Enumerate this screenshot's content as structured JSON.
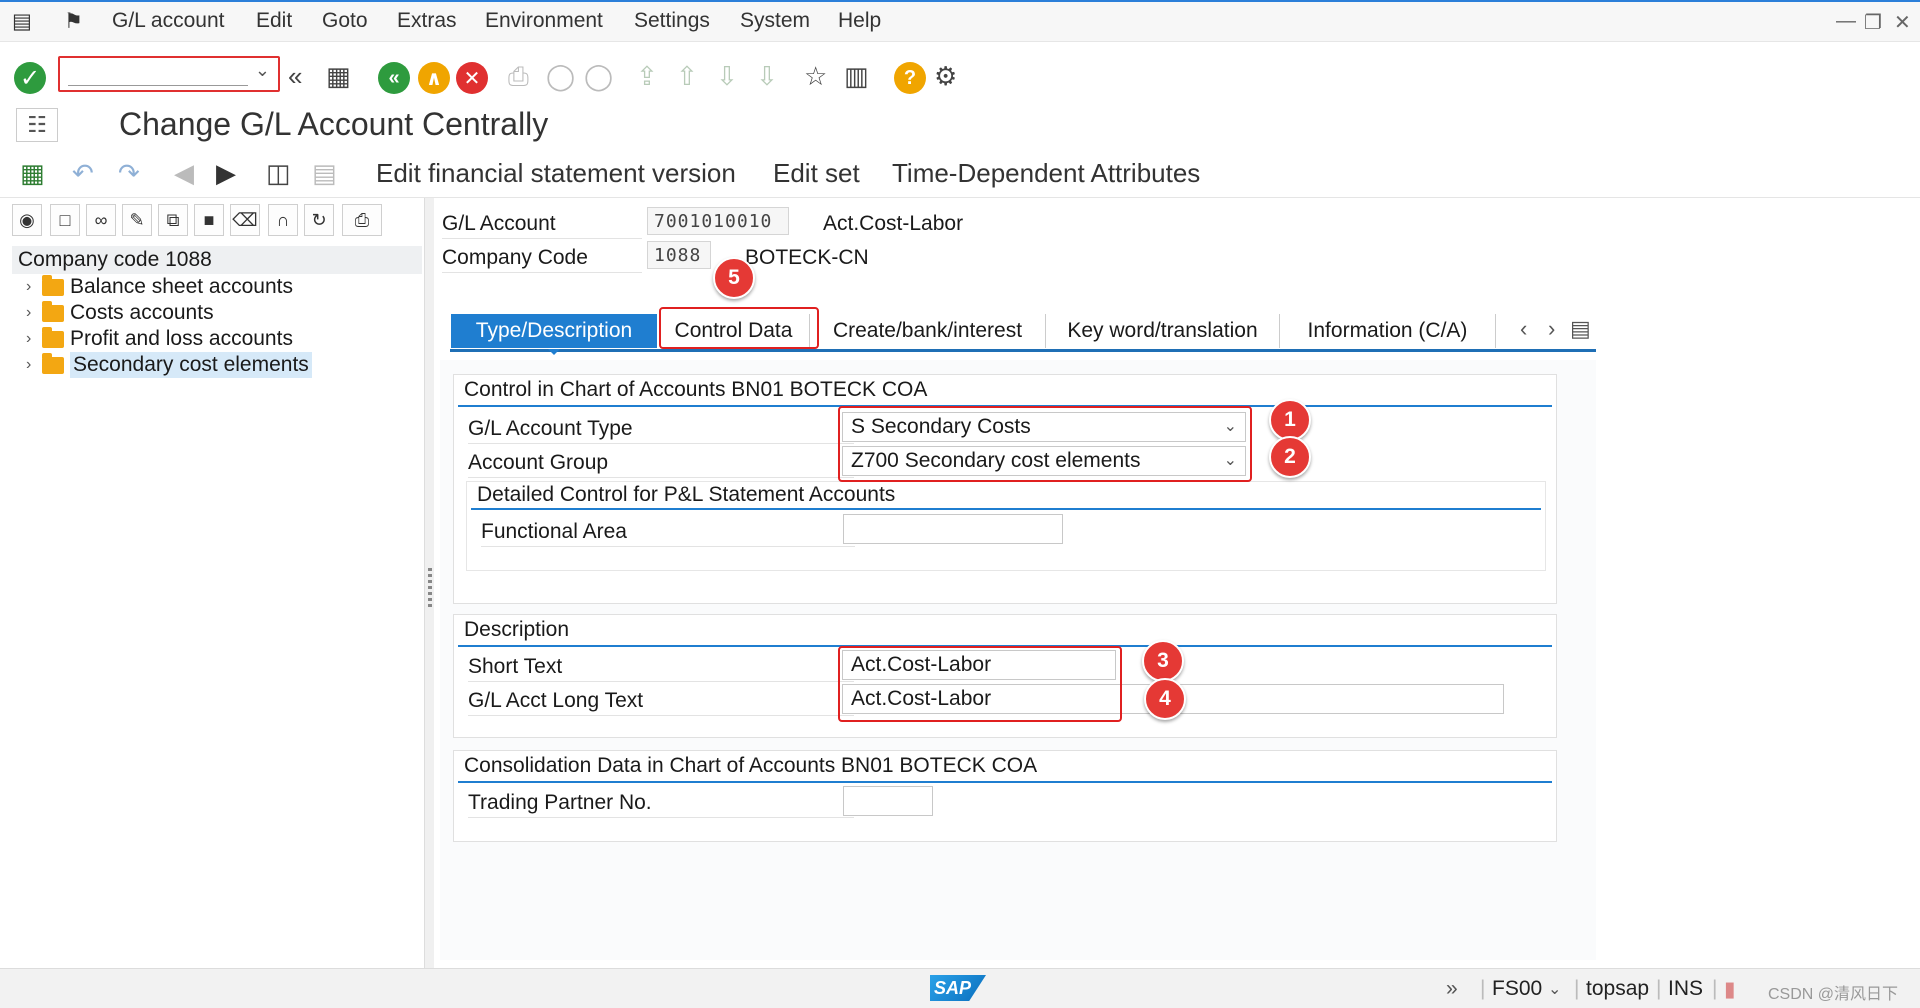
{
  "menu": {
    "items": [
      "G/L account",
      "Edit",
      "Goto",
      "Extras",
      "Environment",
      "Settings",
      "System",
      "Help"
    ]
  },
  "toolbar": {
    "command_value": ""
  },
  "page": {
    "title": "Change G/L Account Centrally"
  },
  "app_toolbar": {
    "buttons": [
      "Edit financial statement version",
      "Edit set",
      "Time-Dependent Attributes"
    ]
  },
  "tree": {
    "header": "Company code 1088",
    "items": [
      "Balance sheet accounts",
      "Costs accounts",
      "Profit and loss accounts",
      "Secondary cost elements"
    ]
  },
  "header_fields": {
    "gl_account_label": "G/L Account",
    "gl_account_value": "7001010010",
    "gl_account_desc": "Act.Cost-Labor",
    "company_code_label": "Company Code",
    "company_code_value": "1088",
    "company_code_desc": "BOTECK-CN"
  },
  "tabs": [
    "Type/Description",
    "Control Data",
    "Create/bank/interest",
    "Key word/translation",
    "Information (C/A)"
  ],
  "control_group": {
    "title": "Control in Chart of Accounts BN01 BOTECK COA",
    "account_type_label": "G/L Account Type",
    "account_type_value": "S Secondary Costs",
    "account_group_label": "Account Group",
    "account_group_value": "Z700 Secondary cost elements",
    "pl_subgroup_title": "Detailed Control for P&L Statement Accounts",
    "functional_area_label": "Functional Area",
    "functional_area_value": ""
  },
  "description_group": {
    "title": "Description",
    "short_text_label": "Short Text",
    "short_text_value": "Act.Cost-Labor",
    "long_text_label": "G/L Acct Long Text",
    "long_text_value": "Act.Cost-Labor"
  },
  "consolidation_group": {
    "title": "Consolidation Data in Chart of Accounts BN01 BOTECK COA",
    "trading_partner_label": "Trading Partner No.",
    "trading_partner_value": ""
  },
  "annotations": [
    "1",
    "2",
    "3",
    "4",
    "5"
  ],
  "statusbar": {
    "logo": "SAP",
    "transaction": "FS00",
    "server": "topsap",
    "mode": "INS",
    "watermark": "CSDN @清风日下"
  },
  "colors": {
    "accent": "#1f7ed0",
    "annotation_red": "#e53935"
  }
}
